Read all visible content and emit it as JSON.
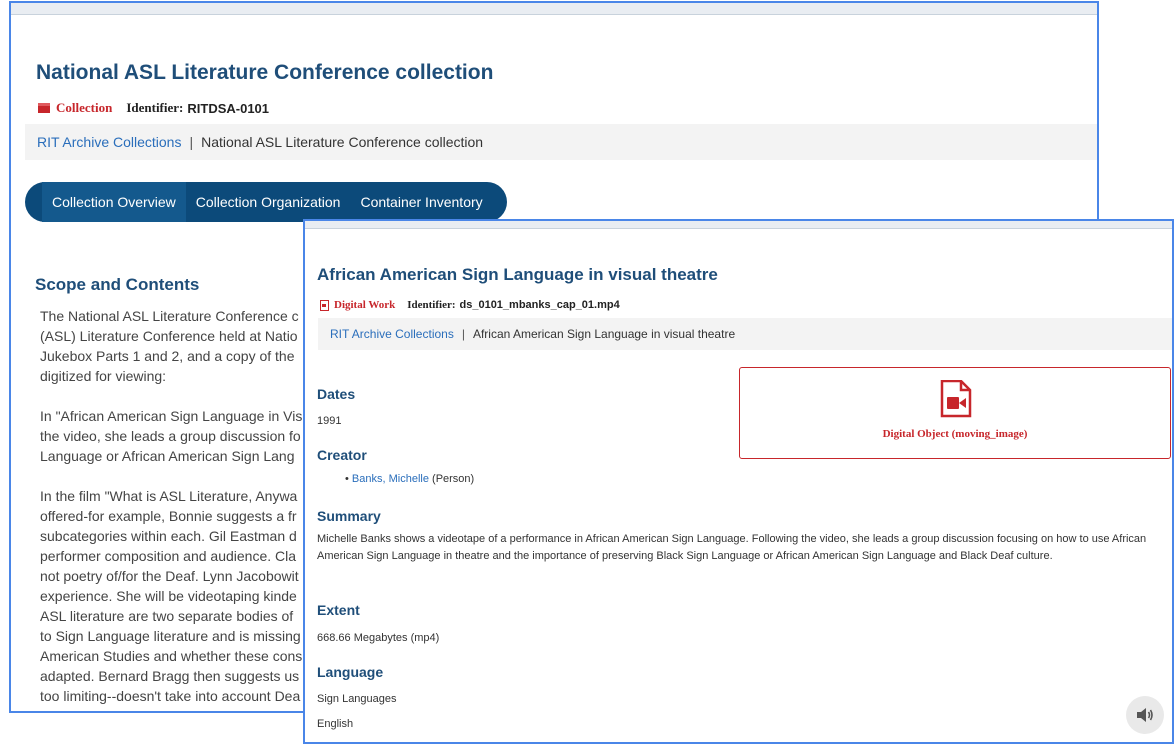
{
  "collection": {
    "title": "National ASL Literature Conference collection",
    "type_label": "Collection",
    "identifier_label": "Identifier:",
    "identifier": "RITDSA-0101",
    "breadcrumb": {
      "root": "RIT Archive Collections",
      "separator": "|",
      "current": "National ASL Literature Conference collection"
    },
    "tabs": [
      {
        "label": "Collection Overview",
        "active": true
      },
      {
        "label": "Collection Organization",
        "active": false
      },
      {
        "label": "Container Inventory",
        "active": false
      }
    ],
    "scope_heading": "Scope and Contents",
    "scope_paragraph_1": [
      "The National ASL Literature Conference c",
      "(ASL) Literature Conference held at Natio",
      "Jukebox Parts 1 and 2, and a copy of the",
      "digitized for viewing:"
    ],
    "scope_paragraph_2": [
      "In \"African American Sign Language in Vis",
      "the video, she leads a group discussion fo",
      "Language or African American Sign Lang"
    ],
    "scope_paragraph_3": [
      "In the film \"What is ASL Literature, Anywa",
      "offered-for example, Bonnie suggests a fr",
      "subcategories within each. Gil Eastman d",
      "performer composition and audience. Cla",
      "not poetry of/for the Deaf. Lynn Jacobowit",
      "experience. She will be videotaping kinde",
      "ASL literature are two separate bodies of",
      "to Sign Language literature and is missing",
      "American Studies and whether these cons",
      "adapted. Bernard Bragg then suggests us",
      "too limiting--doesn't take into account Dea"
    ]
  },
  "digital_work": {
    "title": "African American Sign Language in visual theatre",
    "type_label": "Digital Work",
    "identifier_label": "Identifier:",
    "identifier": "ds_0101_mbanks_cap_01.mp4",
    "breadcrumb": {
      "root": "RIT Archive Collections",
      "separator": "|",
      "current": "African American Sign Language in visual theatre"
    },
    "dates_heading": "Dates",
    "dates_value": "1991",
    "creator_heading": "Creator",
    "creator_name": "Banks, Michelle",
    "creator_role": "(Person)",
    "summary_heading": "Summary",
    "summary_text": "Michelle Banks shows a videotape of a performance in African American Sign Language. Following the video, she leads a group discussion focusing on how to use African American Sign Language in theatre and the importance of preserving Black Sign Language or African American Sign Language and Black Deaf culture.",
    "extent_heading": "Extent",
    "extent_value": "668.66 Megabytes (mp4)",
    "language_heading": "Language",
    "languages": [
      "Sign Languages",
      "English"
    ],
    "digital_object_label": "Digital Object (moving_image)",
    "digital_object_icon": "video-file-icon",
    "speaker_icon": "speaker-icon"
  },
  "colors": {
    "heading": "#1f4e79",
    "link": "#2a6ebb",
    "accent_red": "#c7262b",
    "tab_bar": "#0c4a7a",
    "panel_border": "#4a86e8"
  }
}
